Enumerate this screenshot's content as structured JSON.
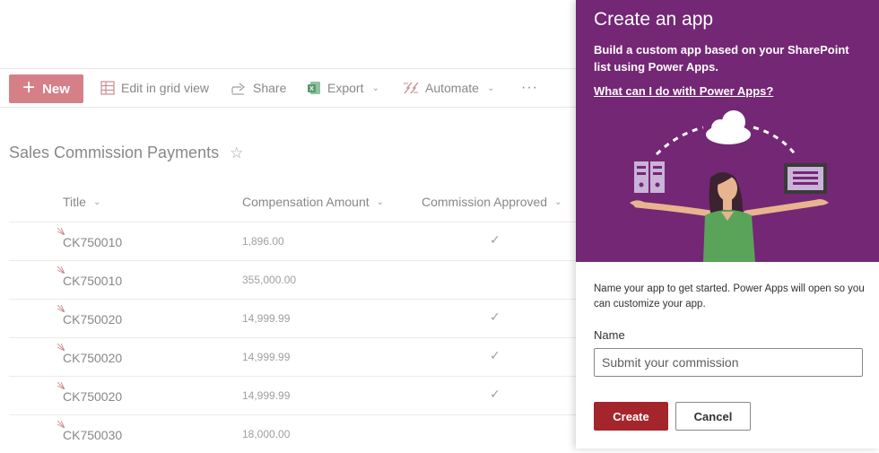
{
  "command_bar": {
    "new_label": "New",
    "edit_grid_label": "Edit in grid view",
    "share_label": "Share",
    "export_label": "Export",
    "automate_label": "Automate",
    "more_label": "···"
  },
  "list": {
    "title": "Sales Commission Payments",
    "columns": [
      {
        "label": "Title"
      },
      {
        "label": "Compensation Amount"
      },
      {
        "label": "Commission Approved"
      }
    ],
    "rows": [
      {
        "title": "CK750010",
        "amount": "1,896.00",
        "approved": "✓"
      },
      {
        "title": "CK750010",
        "amount": "355,000.00",
        "approved": ""
      },
      {
        "title": "CK750020",
        "amount": "14,999.99",
        "approved": "✓"
      },
      {
        "title": "CK750020",
        "amount": "14,999.99",
        "approved": "✓"
      },
      {
        "title": "CK750020",
        "amount": "14,999.99",
        "approved": "✓"
      },
      {
        "title": "CK750030",
        "amount": "18,000.00",
        "approved": ""
      }
    ]
  },
  "panel": {
    "title": "Create an app",
    "description": "Build a custom app based on your SharePoint list using Power Apps.",
    "link_label": "What can I do with Power Apps?",
    "instructions": "Name your app to get started. Power Apps will open so you can customize your app.",
    "name_label": "Name",
    "name_placeholder": "Submit your commission",
    "name_value": "",
    "create_label": "Create",
    "cancel_label": "Cancel"
  },
  "colors": {
    "panel_hero": "#742774",
    "create_button": "#a4262c",
    "new_button_dimmed": "#d58087"
  }
}
